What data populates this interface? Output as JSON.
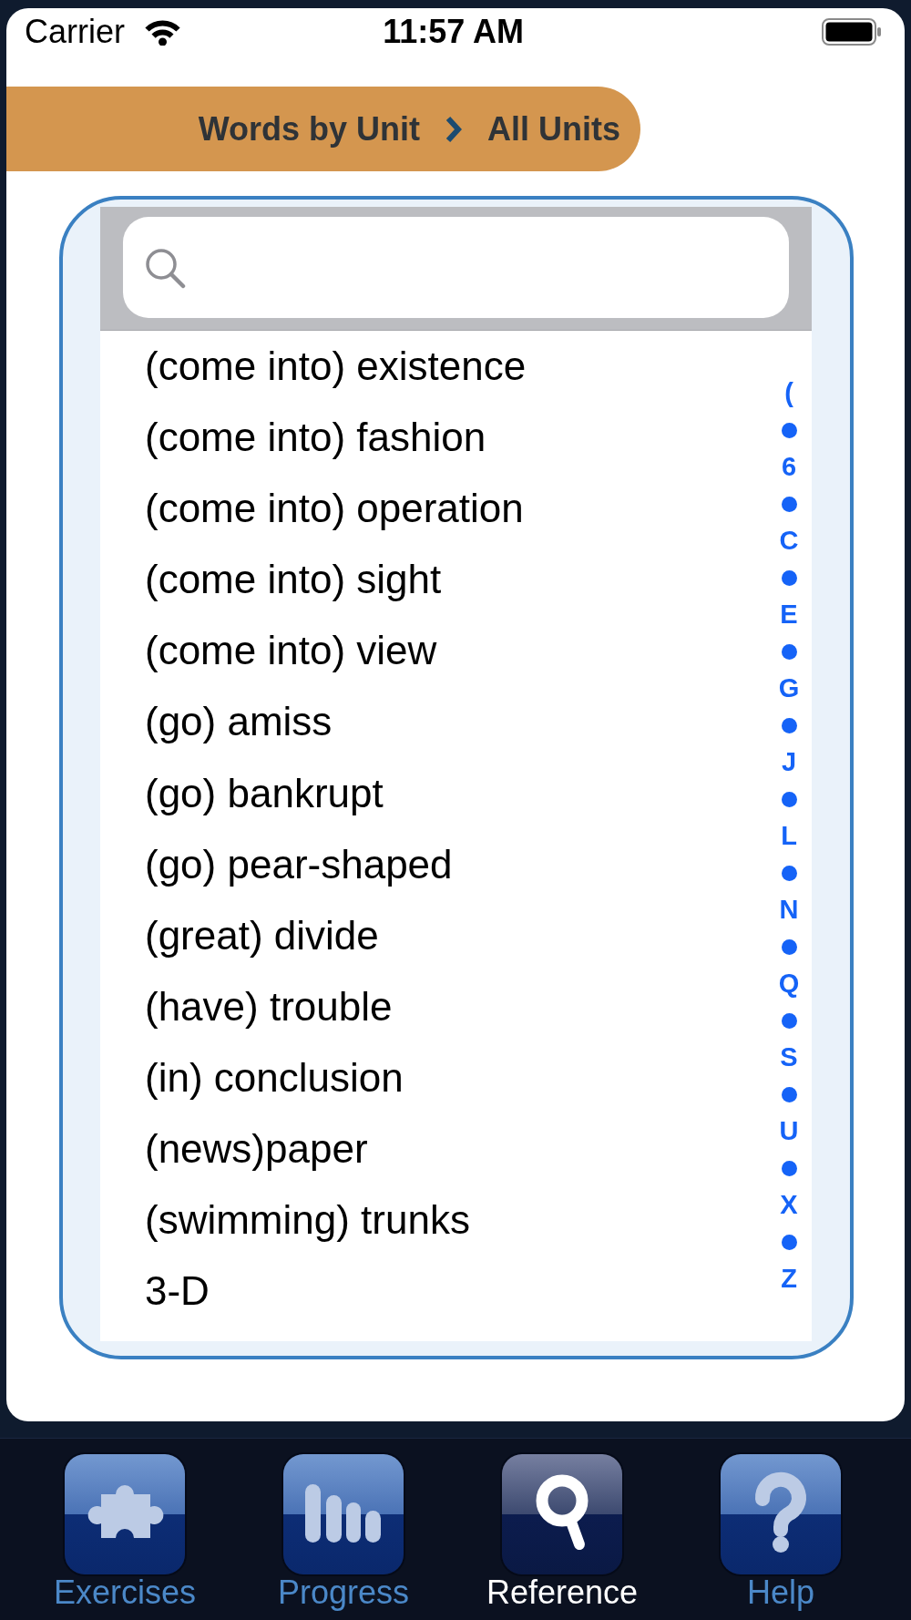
{
  "status_bar": {
    "carrier": "Carrier",
    "time": "11:57 AM"
  },
  "breadcrumb": [
    {
      "label": "Words by Unit"
    },
    {
      "label": "All Units"
    }
  ],
  "word_list": {
    "words": [
      "(come into) existence",
      "(come into) fashion",
      "(come into) operation",
      "(come into) sight",
      "(come into) view",
      "(go) amiss",
      "(go) bankrupt",
      "(go) pear-shaped",
      "(great) divide",
      "(have) trouble",
      "(in) conclusion",
      "(news)paper",
      "(swimming) trunks",
      "3-D"
    ],
    "index": [
      {
        "kind": "letter",
        "label": "("
      },
      {
        "kind": "dot"
      },
      {
        "kind": "letter",
        "label": "6"
      },
      {
        "kind": "dot"
      },
      {
        "kind": "letter",
        "label": "C"
      },
      {
        "kind": "dot"
      },
      {
        "kind": "letter",
        "label": "E"
      },
      {
        "kind": "dot"
      },
      {
        "kind": "letter",
        "label": "G"
      },
      {
        "kind": "dot"
      },
      {
        "kind": "letter",
        "label": "J"
      },
      {
        "kind": "dot"
      },
      {
        "kind": "letter",
        "label": "L"
      },
      {
        "kind": "dot"
      },
      {
        "kind": "letter",
        "label": "N"
      },
      {
        "kind": "dot"
      },
      {
        "kind": "letter",
        "label": "Q"
      },
      {
        "kind": "dot"
      },
      {
        "kind": "letter",
        "label": "S"
      },
      {
        "kind": "dot"
      },
      {
        "kind": "letter",
        "label": "U"
      },
      {
        "kind": "dot"
      },
      {
        "kind": "letter",
        "label": "X"
      },
      {
        "kind": "dot"
      },
      {
        "kind": "letter",
        "label": "Z"
      }
    ]
  },
  "tab_bar": {
    "tabs": [
      {
        "label": "Exercises",
        "selected": false
      },
      {
        "label": "Progress",
        "selected": false
      },
      {
        "label": "Reference",
        "selected": true
      },
      {
        "label": "Help",
        "selected": false
      }
    ]
  }
}
